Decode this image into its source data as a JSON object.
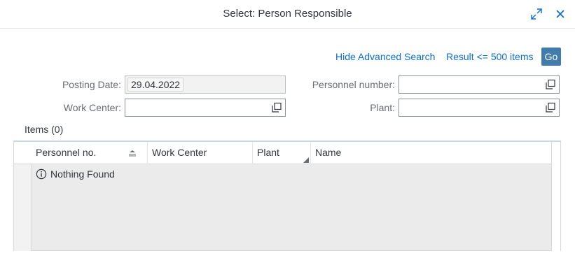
{
  "dialog": {
    "title": "Select: Person Responsible",
    "resize_icon": "resize-icon",
    "close_icon": "close-icon"
  },
  "toolbar": {
    "hide_advanced": "Hide Advanced Search",
    "result_limit": "Result <= 500 items",
    "go_label": "Go"
  },
  "filters": {
    "posting_date": {
      "label": "Posting Date:",
      "value": "29.04.2022"
    },
    "work_center": {
      "label": "Work Center:",
      "value": ""
    },
    "personnel_number": {
      "label": "Personnel number:",
      "value": ""
    },
    "plant": {
      "label": "Plant:",
      "value": ""
    }
  },
  "items": {
    "title": "Items (0)",
    "columns": [
      "Personnel no.",
      "Work Center",
      "Plant",
      "Name"
    ],
    "empty_text": "Nothing Found"
  },
  "colors": {
    "accent": "#0a6ed1",
    "go_button": "#427cac"
  }
}
